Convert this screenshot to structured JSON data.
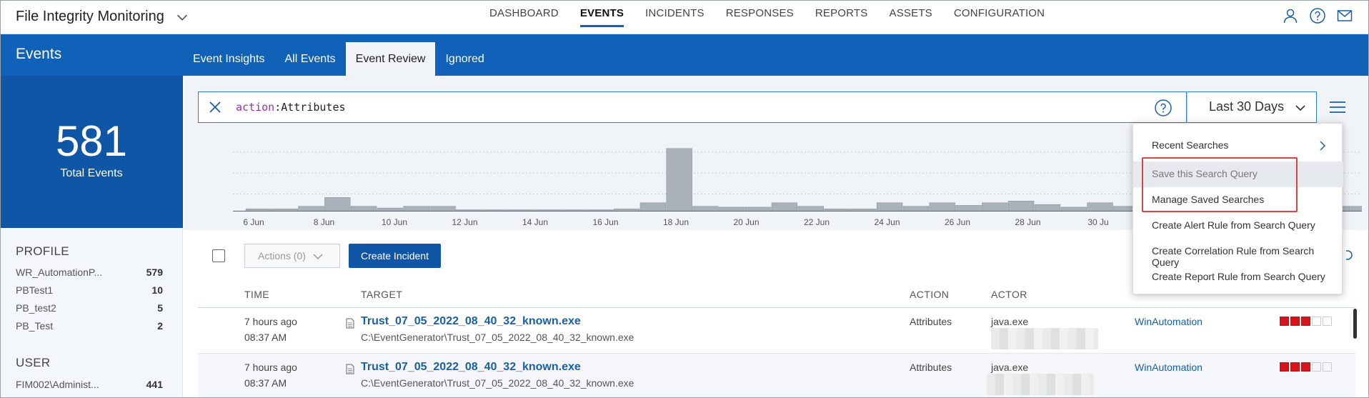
{
  "app": {
    "title": "File Integrity Monitoring"
  },
  "nav": [
    "DASHBOARD",
    "EVENTS",
    "INCIDENTS",
    "RESPONSES",
    "REPORTS",
    "ASSETS",
    "CONFIGURATION"
  ],
  "nav_active": "EVENTS",
  "section": {
    "title": "Events"
  },
  "subtabs": [
    "Event Insights",
    "All Events",
    "Event Review",
    "Ignored"
  ],
  "subtab_active": "Event Review",
  "summary": {
    "count": "581",
    "label": "Total Events"
  },
  "profile": {
    "heading": "PROFILE",
    "items": [
      {
        "name": "WR_AutomationP...",
        "count": "579"
      },
      {
        "name": "PBTest1",
        "count": "10"
      },
      {
        "name": "PB_test2",
        "count": "5"
      },
      {
        "name": "PB_Test",
        "count": "2"
      }
    ]
  },
  "user": {
    "heading": "USER",
    "items": [
      {
        "name": "FIM002\\Administ...",
        "count": "441"
      }
    ]
  },
  "search": {
    "keyword": "action",
    "value": "Attributes"
  },
  "date_range": "Last 30 Days",
  "histogram": {
    "ticks": [
      "6 Jun",
      "8 Jun",
      "10 Jun",
      "12 Jun",
      "14 Jun",
      "16 Jun",
      "18 Jun",
      "20 Jun",
      "22 Jun",
      "24 Jun",
      "26 Jun",
      "28 Jun",
      "30 Ju"
    ],
    "values": [
      3,
      3,
      6,
      16,
      6,
      4,
      6,
      6,
      2,
      2,
      2,
      2,
      2,
      2,
      3,
      10,
      72,
      6,
      5,
      5,
      10,
      6,
      3,
      3,
      10,
      6,
      10,
      7,
      10,
      12,
      8,
      5,
      10,
      6,
      6,
      6,
      6,
      6,
      6,
      6,
      6,
      6,
      6
    ]
  },
  "menu": {
    "items": [
      {
        "label": "Recent Searches",
        "has_submenu": true
      },
      {
        "label": "Save this Search Query"
      },
      {
        "label": "Manage Saved Searches"
      },
      {
        "label": "Create Alert Rule from Search Query"
      },
      {
        "label": "Create Correlation Rule from Search Query"
      },
      {
        "label": "Create Report Rule from Search Query"
      }
    ]
  },
  "toolbar": {
    "actions_label": "Actions (0)",
    "create_label": "Create Incident"
  },
  "table": {
    "headers": {
      "time": "TIME",
      "target": "TARGET",
      "action": "ACTION",
      "actor": "ACTOR"
    },
    "rows": [
      {
        "time": "7 hours ago",
        "clock": "08:37 AM",
        "target": "Trust_07_05_2022_08_40_32_known.exe",
        "path": "C:\\EventGenerator\\Trust_07_05_2022_08_40_32_known.exe",
        "action": "Attributes",
        "actor": "java.exe",
        "asset": "WinAutomation",
        "severity": 3
      },
      {
        "time": "7 hours ago",
        "clock": "08:37 AM",
        "target": "Trust_07_05_2022_08_40_32_known.exe",
        "path": "C:\\EventGenerator\\Trust_07_05_2022_08_40_32_known.exe",
        "action": "Attributes",
        "actor": "java.exe",
        "asset": "WinAutomation",
        "severity": 3
      }
    ]
  },
  "colors": {
    "brand_blue": "#0f62b8",
    "panel_blue": "#0f57a6",
    "severity_red": "#d8141b",
    "highlight_red": "#e0403e"
  }
}
